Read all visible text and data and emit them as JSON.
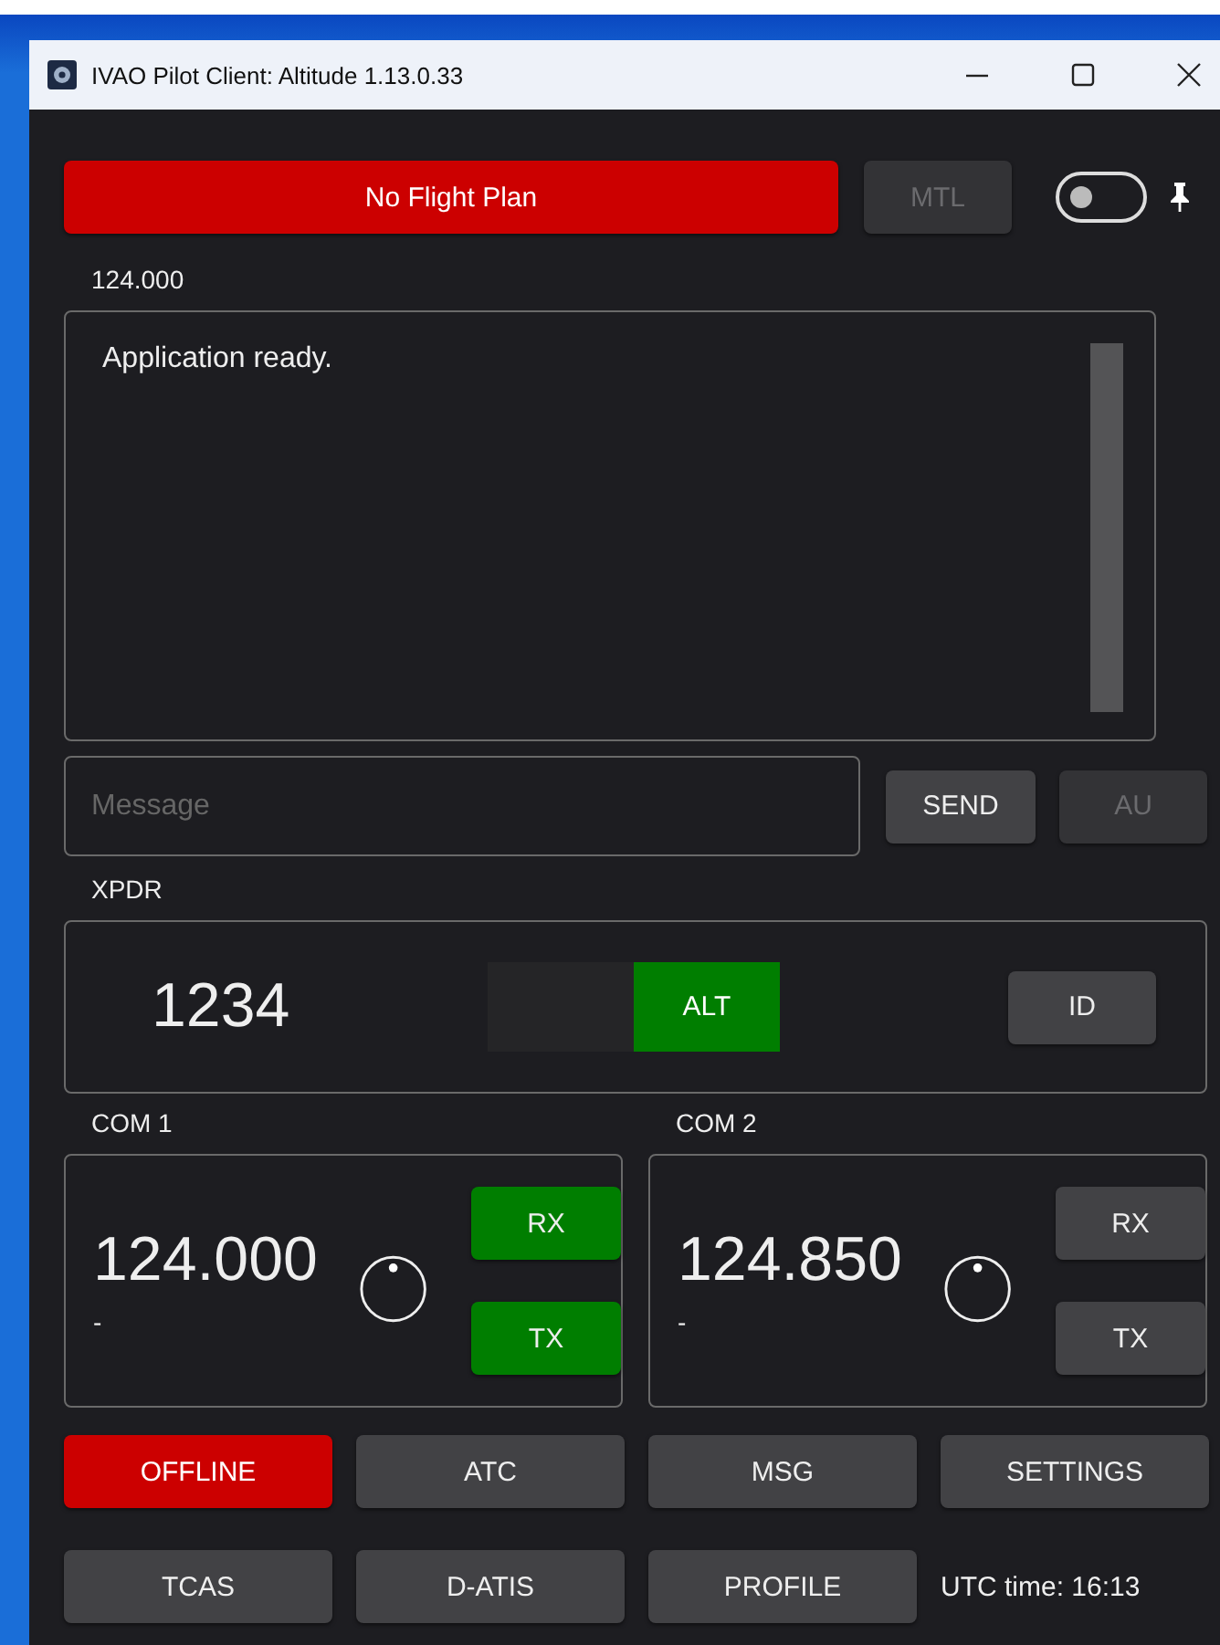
{
  "window": {
    "title": "IVAO Pilot Client: Altitude 1.13.0.33"
  },
  "flight_plan_button": {
    "label": "No Flight Plan"
  },
  "mtl_button": {
    "label": "MTL",
    "disabled": true
  },
  "toggle": {
    "on": false
  },
  "frequency_label": "124.000",
  "log": {
    "lines": [
      "Application ready."
    ]
  },
  "message": {
    "placeholder": "Message"
  },
  "send_button": {
    "label": "SEND",
    "disabled": false
  },
  "au_button": {
    "label": "AU",
    "disabled": true
  },
  "xpdr": {
    "label": "XPDR",
    "code": "1234",
    "modes": [
      {
        "selected": false
      },
      {
        "label": "ALT",
        "selected": true
      }
    ],
    "id_button": "ID"
  },
  "coms": [
    {
      "label": "COM 1",
      "frequency": "124.000",
      "station": "-",
      "rx": {
        "label": "RX",
        "on": true
      },
      "tx": {
        "label": "TX",
        "on": true
      }
    },
    {
      "label": "COM 2",
      "frequency": "124.850",
      "station": "-",
      "rx": {
        "label": "RX",
        "on": false
      },
      "tx": {
        "label": "TX",
        "on": false
      }
    }
  ],
  "buttons": [
    {
      "label": "OFFLINE",
      "kind": "alert"
    },
    {
      "label": "ATC",
      "kind": "normal"
    },
    {
      "label": "MSG",
      "kind": "normal"
    },
    {
      "label": "SETTINGS",
      "kind": "normal"
    },
    {
      "label": "TCAS",
      "kind": "normal"
    },
    {
      "label": "D-ATIS",
      "kind": "normal"
    },
    {
      "label": "PROFILE",
      "kind": "normal"
    }
  ],
  "utc_time": "UTC time: 16:13"
}
